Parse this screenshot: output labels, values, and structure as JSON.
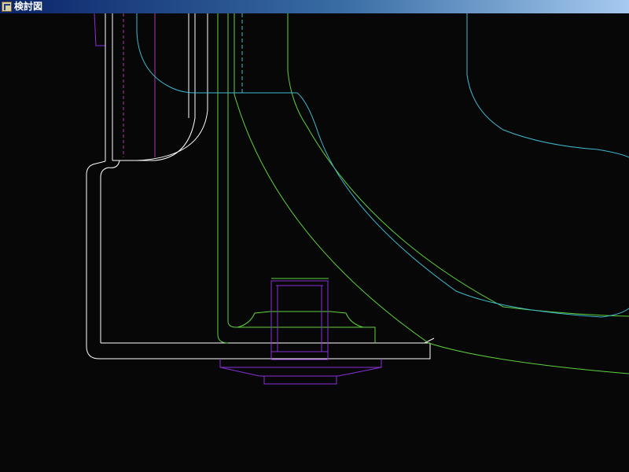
{
  "window": {
    "title": "検討図",
    "icon": "cad-app-icon"
  },
  "drawing": {
    "background_color": "#070707",
    "line_colors": {
      "outline": "#ffffff",
      "green": "#5ed33a",
      "cyan": "#3fb8cf",
      "purple": "#8b2fd8",
      "magenta": "#b03aa8"
    }
  }
}
